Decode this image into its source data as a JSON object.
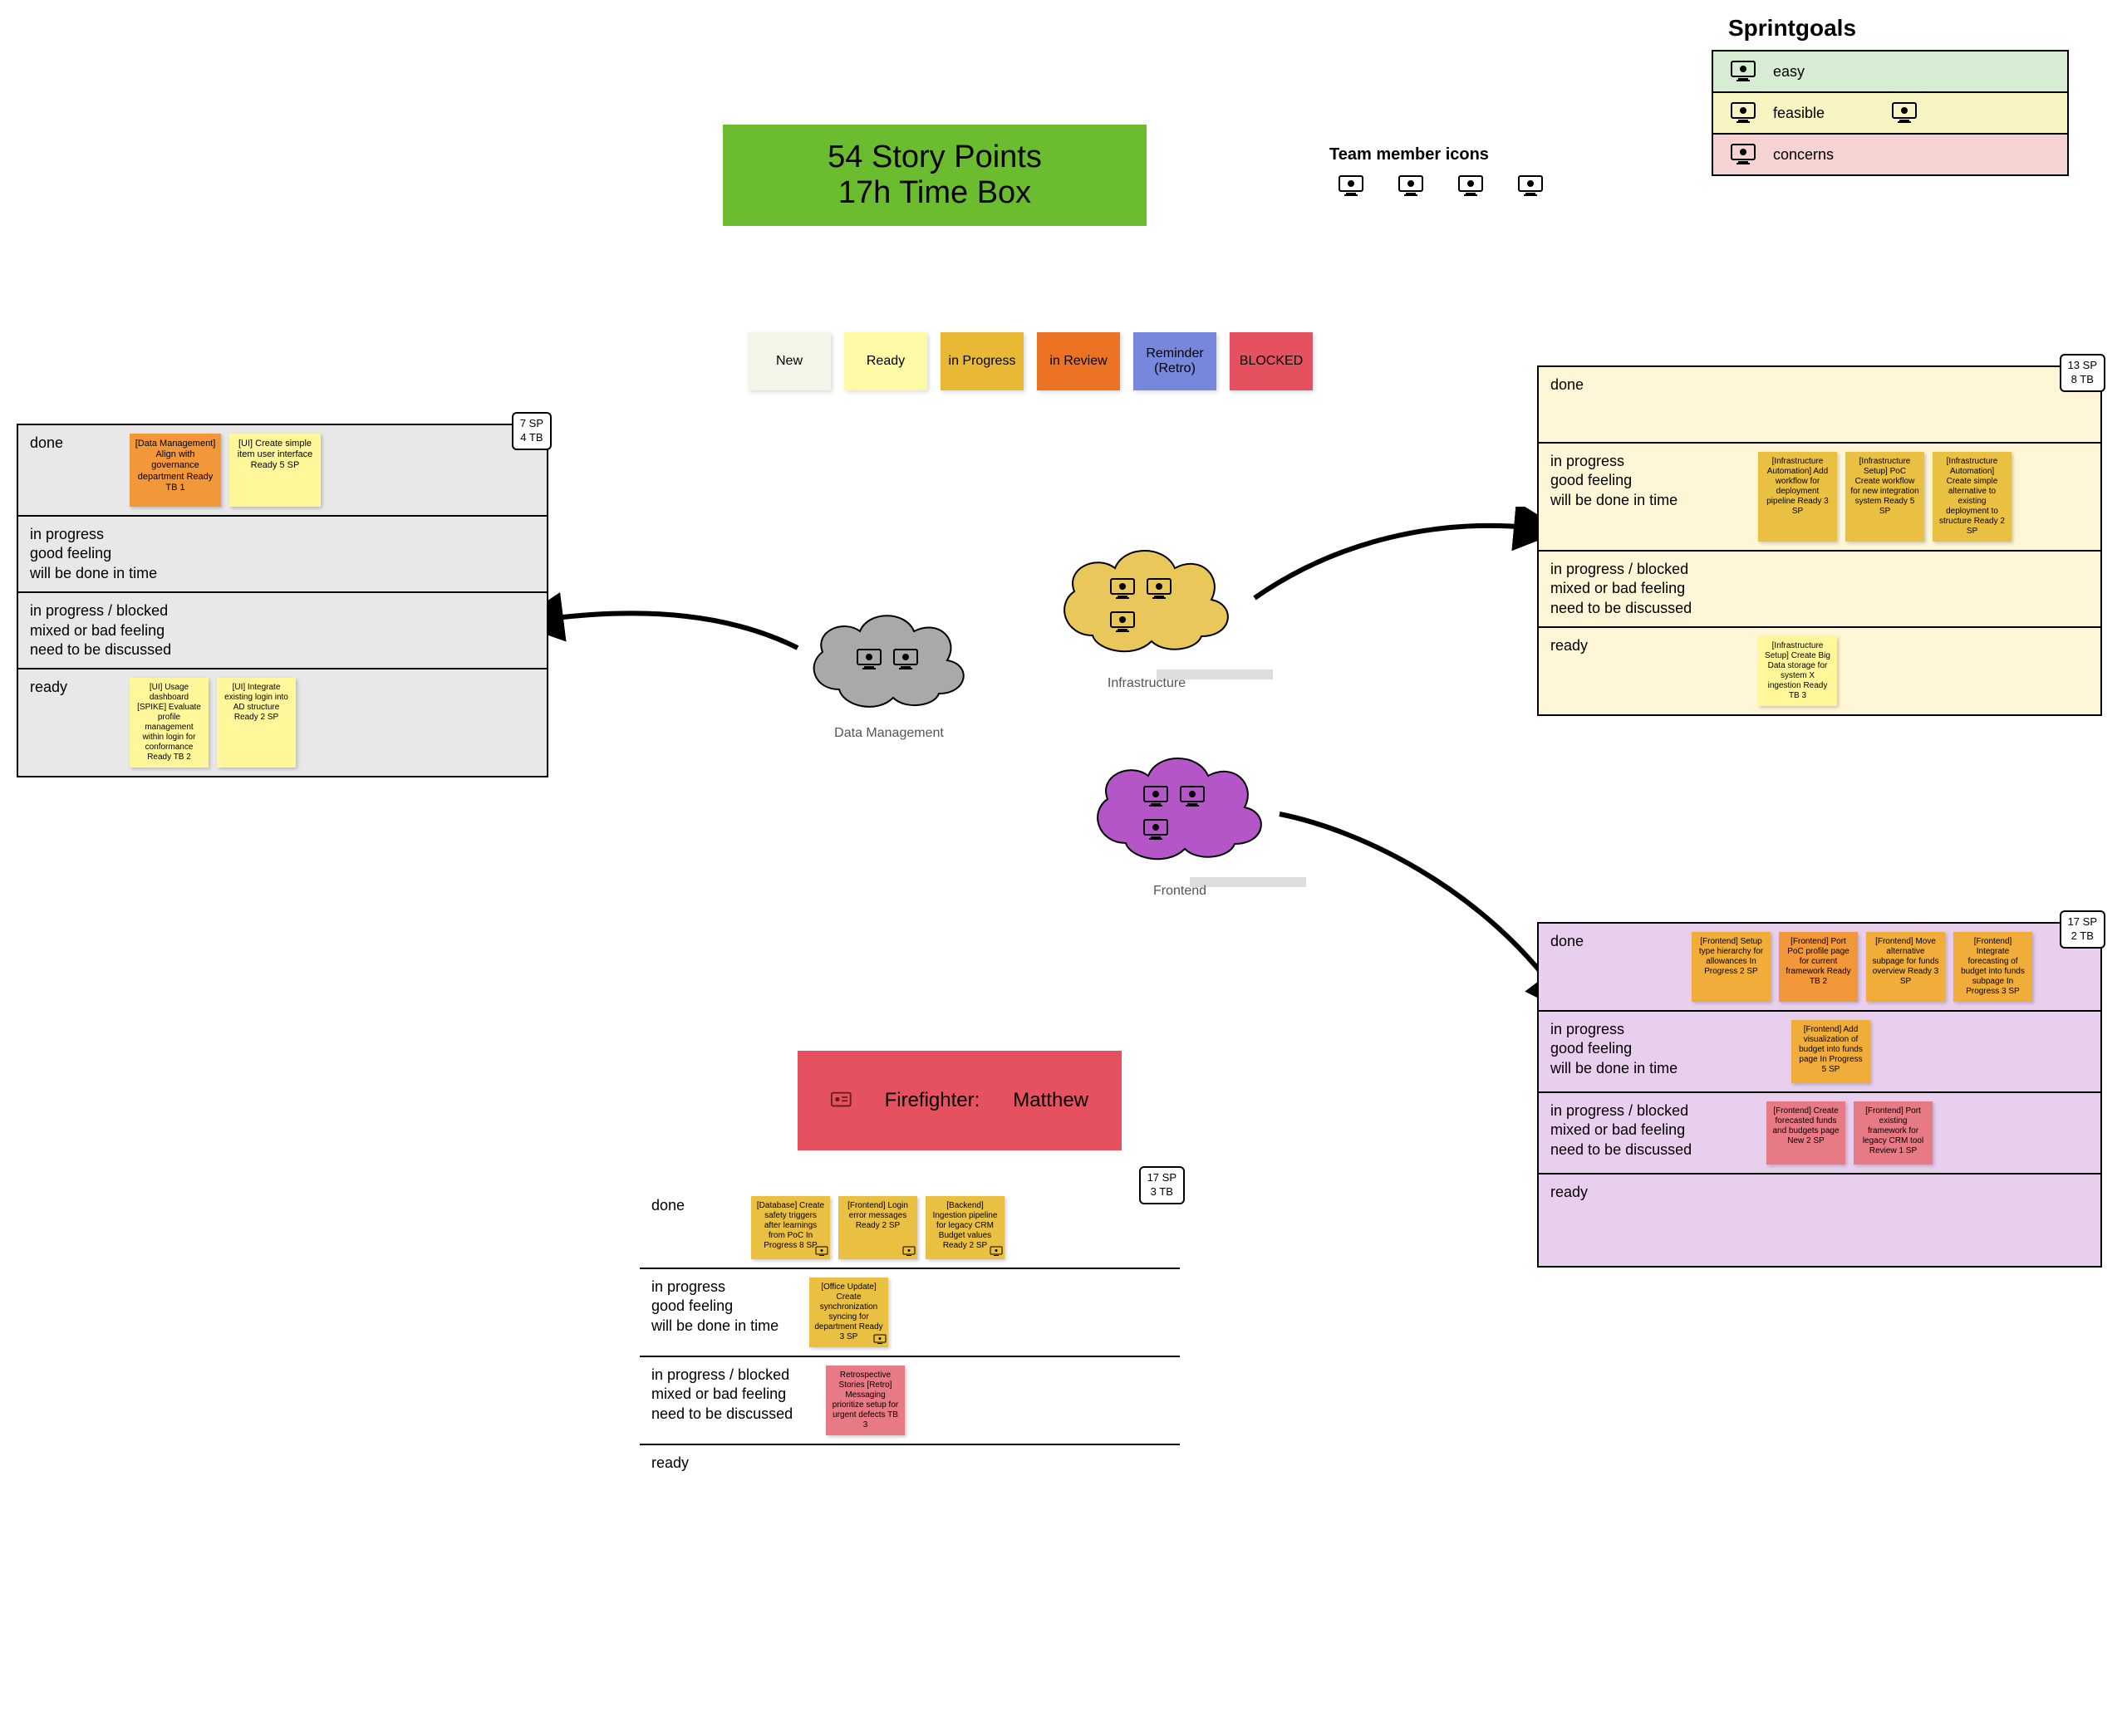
{
  "banner": {
    "line1": "54 Story Points",
    "line2": "17h Time Box"
  },
  "team_label": "Team member icons",
  "sprintgoals": {
    "title": "Sprintgoals",
    "rows": [
      {
        "label": "easy",
        "icons": 1
      },
      {
        "label": "feasible",
        "icons": 2
      },
      {
        "label": "concerns",
        "icons": 1
      }
    ]
  },
  "legend": [
    {
      "label": "New",
      "cls": "note-new"
    },
    {
      "label": "Ready",
      "cls": "note-ready"
    },
    {
      "label": "in Progress",
      "cls": "note-progress"
    },
    {
      "label": "in Review",
      "cls": "note-review"
    },
    {
      "label": "Reminder (Retro)",
      "cls": "note-reminder"
    },
    {
      "label": "BLOCKED",
      "cls": "note-blocked"
    }
  ],
  "clouds": {
    "data": {
      "label": "Data Management"
    },
    "infra": {
      "label": "Infrastructure"
    },
    "frontend": {
      "label": "Frontend"
    }
  },
  "rowLabels": {
    "done": "done",
    "inprogress": "in progress\ngood feeling\nwill be done in time",
    "blocked": "in progress / blocked\nmixed or bad feeling\nneed to be discussed",
    "ready": "ready"
  },
  "boards": {
    "grey": {
      "badge": "7 SP\n4 TB",
      "done": [
        {
          "text": "[Data Management] Align with governance department\nReady\nTB 1",
          "cls": "s-orange"
        },
        {
          "text": "[UI] Create simple item user interface\nReady\n5 SP",
          "cls": "s-yellow"
        }
      ],
      "ready": [
        {
          "text": "[UI] Usage dashboard [SPIKE] Evaluate profile management within login for conformance\nReady\nTB 2",
          "cls": "s-yellow"
        },
        {
          "text": "[UI] Integrate existing login into AD structure\nReady\n2 SP",
          "cls": "s-yellow"
        }
      ]
    },
    "yellow": {
      "badge": "13 SP\n8 TB",
      "inprogress": [
        {
          "text": "[Infrastructure Automation] Add workflow for deployment pipeline\nReady\n3 SP",
          "cls": "s-gold"
        },
        {
          "text": "[Infrastructure Setup] PoC Create workflow for new integration system\nReady\n5 SP",
          "cls": "s-gold"
        },
        {
          "text": "[Infrastructure Automation] Create simple alternative to existing deployment to structure\nReady\n2 SP",
          "cls": "s-gold"
        }
      ],
      "ready": [
        {
          "text": "[Infrastructure Setup] Create Big Data storage for system X ingestion\nReady\nTB 3",
          "cls": "s-yellow"
        }
      ]
    },
    "purple": {
      "badge": "17 SP\n2 TB",
      "done": [
        {
          "text": "[Frontend] Setup type hierarchy for allowances\nIn Progress\n2 SP",
          "cls": "s-amber"
        },
        {
          "text": "[Frontend] Port PoC profile page for current framework\nReady\nTB 2",
          "cls": "s-orange"
        },
        {
          "text": "[Frontend] Move alternative subpage for funds overview\nReady\n3 SP",
          "cls": "s-amber"
        },
        {
          "text": "[Frontend] Integrate forecasting of budget into funds subpage\nIn Progress\n3 SP",
          "cls": "s-amber"
        }
      ],
      "inprogress": [
        {
          "text": "[Frontend] Add visualization of budget into funds page\nIn Progress\n5 SP",
          "cls": "s-amber"
        }
      ],
      "blocked": [
        {
          "text": "[Frontend] Create forecasted funds and budgets page\nNew\n2 SP",
          "cls": "s-red"
        },
        {
          "text": "[Frontend] Port existing framework for legacy CRM tool\nReview\n1 SP",
          "cls": "s-red"
        }
      ]
    },
    "white": {
      "badge": "17 SP\n3 TB",
      "done": [
        {
          "text": "[Database] Create safety triggers after learnings from PoC\nIn Progress\n8 SP",
          "cls": "s-gold"
        },
        {
          "text": "[Frontend] Login error messages\nReady\n2 SP",
          "cls": "s-gold"
        },
        {
          "text": "[Backend] Ingestion pipeline for legacy CRM Budget values\nReady\n2 SP",
          "cls": "s-gold"
        }
      ],
      "inprogress": [
        {
          "text": "[Office Update] Create synchronization syncing for department\nReady\n3 SP",
          "cls": "s-gold"
        }
      ],
      "blocked": [
        {
          "text": "Retrospective Stories\n[Retro] Messaging prioritize setup for urgent defects\nTB 3",
          "cls": "s-red"
        }
      ]
    }
  },
  "firefighter": {
    "role": "Firefighter:",
    "name": "Matthew"
  }
}
